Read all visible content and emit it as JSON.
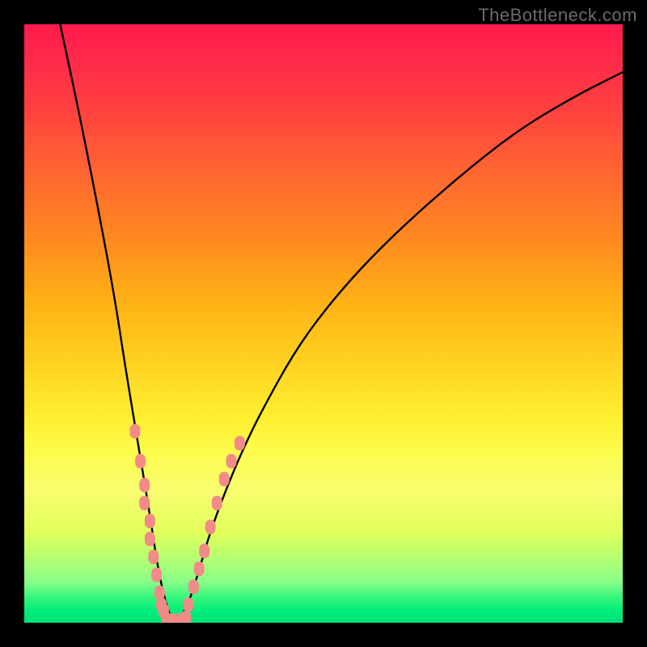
{
  "watermark": {
    "text": "TheBottleneck.com"
  },
  "chart_data": {
    "type": "line",
    "title": "",
    "xlabel": "",
    "ylabel": "",
    "xlim": [
      0,
      100
    ],
    "ylim": [
      0,
      100
    ],
    "background_gradient": {
      "direction": "vertical",
      "stops": [
        {
          "pos": 0.0,
          "color": "#ff1a4d"
        },
        {
          "pos": 0.26,
          "color": "#ff6a30"
        },
        {
          "pos": 0.56,
          "color": "#ffd020"
        },
        {
          "pos": 0.78,
          "color": "#f8fd70"
        },
        {
          "pos": 0.93,
          "color": "#8cff88"
        },
        {
          "pos": 1.0,
          "color": "#00e078"
        }
      ]
    },
    "series": [
      {
        "name": "bottleneck-v-curve",
        "note": "V-shaped curve; y is bottleneck percentage, minimum near x≈25 at y≈0",
        "x": [
          6,
          9,
          12,
          15,
          17,
          19,
          21,
          22.5,
          24,
          25,
          27,
          29,
          31,
          34,
          37,
          40,
          45,
          50,
          56,
          63,
          72,
          82,
          92,
          100
        ],
        "y": [
          100,
          86,
          71,
          55,
          42,
          30,
          18,
          8,
          2,
          0,
          2,
          8,
          15,
          23,
          30,
          36,
          45,
          52,
          59,
          66,
          74,
          82,
          88,
          92
        ]
      },
      {
        "name": "sample-dots-left",
        "type": "scatter",
        "color": "#f18b88",
        "x": [
          18.5,
          19.4,
          20.1,
          20.1,
          21.0,
          21.0,
          21.6,
          22.1,
          22.6,
          22.9,
          23.3
        ],
        "y": [
          32,
          27,
          23,
          20,
          17,
          14,
          11,
          8,
          5,
          3,
          2
        ]
      },
      {
        "name": "sample-dots-right",
        "type": "scatter",
        "color": "#f18b88",
        "x": [
          27.4,
          28.3,
          29.2,
          30.1,
          31.1,
          32.2,
          33.4,
          34.6,
          36.0
        ],
        "y": [
          3,
          6,
          9,
          12,
          16,
          20,
          24,
          27,
          30
        ]
      },
      {
        "name": "sample-dots-bottom",
        "type": "scatter",
        "color": "#f18b88",
        "x": [
          23.8,
          24.6,
          25.4,
          26.2,
          27.0
        ],
        "y": [
          0.5,
          0.3,
          0.3,
          0.4,
          0.8
        ]
      }
    ]
  }
}
